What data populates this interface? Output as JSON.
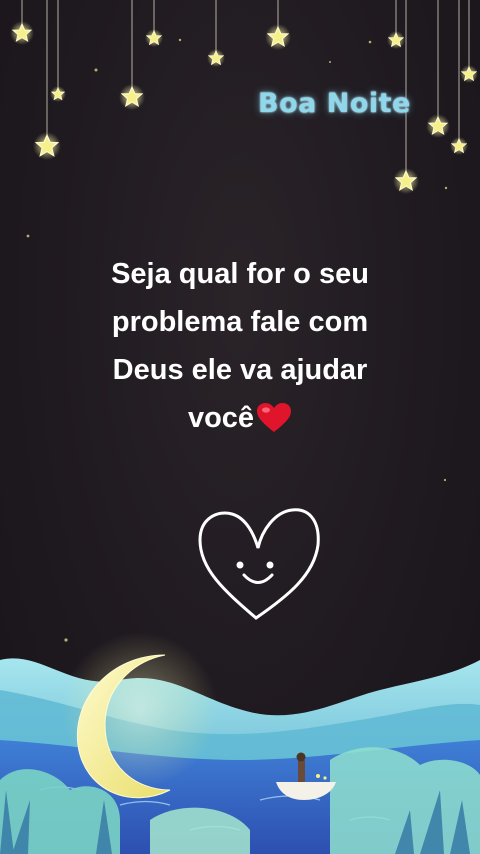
{
  "greeting": {
    "text": "Boa Noite"
  },
  "message": {
    "lines": [
      "Seja qual for o seu",
      "problema fale com",
      "Deus ele va ajudar",
      "você"
    ],
    "emoji": "red-heart-icon"
  },
  "icons": [
    "hanging-star-icon",
    "smiling-heart-icon",
    "crescent-moon-icon",
    "boat-icon",
    "red-heart-icon"
  ],
  "colors": {
    "background": "#1f1a20",
    "greeting": "#8fd8ec",
    "message": "#ffffff",
    "star": "#f6f08a",
    "moon": "#f4f0a8",
    "heart_emoji": "#e0142a",
    "hills": "#6fc7d4",
    "water": "#3f7fd6"
  }
}
